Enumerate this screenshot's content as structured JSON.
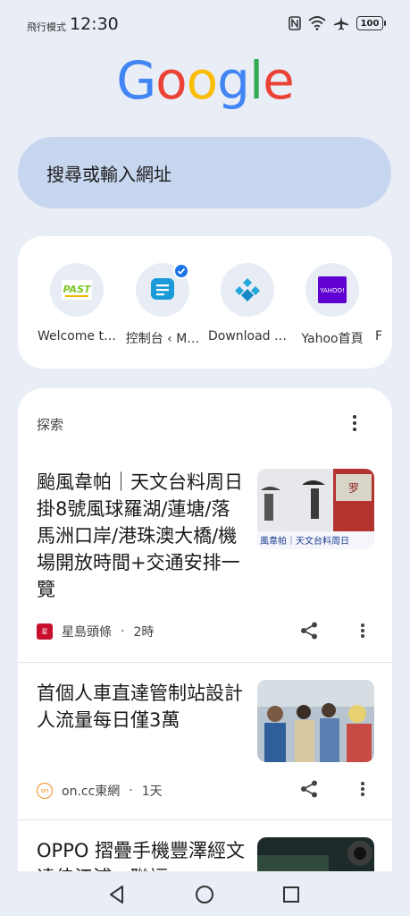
{
  "status_bar": {
    "mode": "飛行模式",
    "time": "12:30",
    "battery": "100"
  },
  "logo": {
    "letters": [
      "G",
      "o",
      "o",
      "g",
      "l",
      "e"
    ],
    "colors": [
      "#4285F4",
      "#EA4335",
      "#FBBC05",
      "#4285F4",
      "#34A853",
      "#EA4335"
    ]
  },
  "search": {
    "placeholder": "搜尋或輸入網址"
  },
  "shortcuts": [
    {
      "label": "Welcome t…",
      "icon": "past-icon"
    },
    {
      "label": "控制台 ‹ M…",
      "icon": "message-board-icon"
    },
    {
      "label": "Download …",
      "icon": "download-diamond-icon"
    },
    {
      "label": "Yahoo首頁",
      "icon": "yahoo-icon"
    },
    {
      "label": "F",
      "icon": "partial-icon"
    }
  ],
  "yahoo_icon_text": "YAHOO!",
  "past_icon_text": "PAST",
  "feed": {
    "header": "探索",
    "articles": [
      {
        "title": "颱風韋帕｜天文台料周日掛8號風球羅湖/蓮塘/落馬洲口岸/港珠澳大橋/機場開放時間+交通安排一覽",
        "source": "星島頭條",
        "time": "2時",
        "thumb_caption": "風韋帕｜天文台料周日"
      },
      {
        "title": "首個人車直達管制站設計人流量每日僅3萬",
        "source": "on.cc東網",
        "time": "1天"
      },
      {
        "title": "OPPO 摺疊手機豐澤經文達佳江浦、聯福",
        "source": "",
        "time": ""
      }
    ]
  },
  "colors": {
    "background": "#e9edf6",
    "search_bg": "#c7d6ef",
    "card_bg": "#ffffff",
    "accent_blue": "#1a73e8"
  }
}
